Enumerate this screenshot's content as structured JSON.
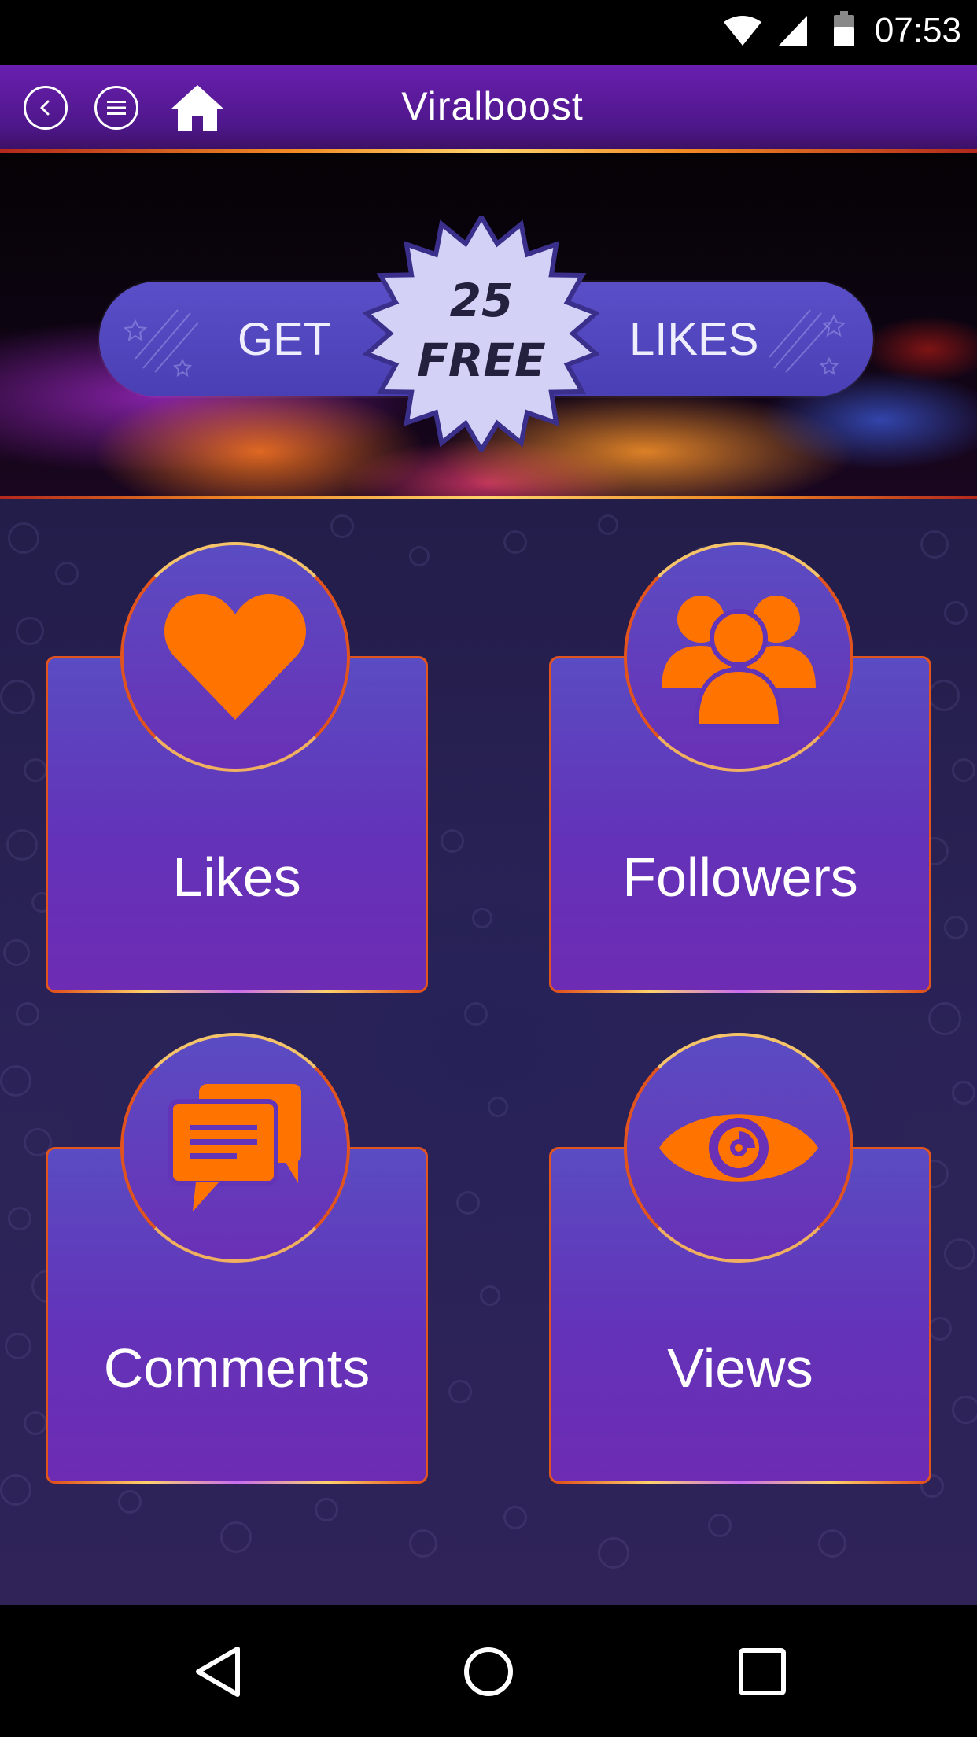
{
  "status_bar": {
    "time": "07:53",
    "icons": [
      "wifi-icon",
      "cell-signal-icon",
      "battery-icon"
    ]
  },
  "app_bar": {
    "title": "Viralboost",
    "back_icon": "chevron-left-icon",
    "menu_icon": "menu-icon",
    "home_icon": "home-icon"
  },
  "promo": {
    "left_text": "GET",
    "right_text": "LIKES",
    "badge_number": "25",
    "badge_text": "FREE"
  },
  "cards": [
    {
      "label": "Likes",
      "icon": "heart-icon"
    },
    {
      "label": "Followers",
      "icon": "users-icon"
    },
    {
      "label": "Comments",
      "icon": "chat-icon"
    },
    {
      "label": "Views",
      "icon": "eye-icon"
    }
  ],
  "colors": {
    "accent_orange": "#ff7300",
    "app_bar_purple": "#5a1a9e",
    "card_purple": "#6332b8",
    "badge_fill": "#d4d1f7"
  },
  "nav_bar": {
    "icons": [
      "back-triangle-icon",
      "home-circle-icon",
      "recents-square-icon"
    ]
  }
}
